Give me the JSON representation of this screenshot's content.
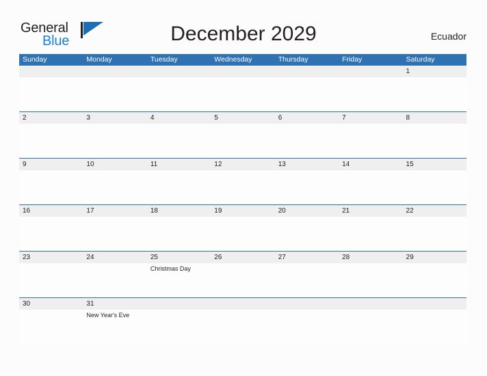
{
  "brand": {
    "name_part1": "General",
    "name_part2": "Blue",
    "flag_color": "#1f6eb4",
    "text_color": "#231f20",
    "blue_text_color": "#1b7fd4"
  },
  "header": {
    "title": "December 2029",
    "country": "Ecuador"
  },
  "theme": {
    "header_blue": "#2e72b4",
    "date_band_gray": "#efefef",
    "body_white": "#fdfdfd",
    "text_dark": "#231f20"
  },
  "calendar": {
    "weekdays": [
      "Sunday",
      "Monday",
      "Tuesday",
      "Wednesday",
      "Thursday",
      "Friday",
      "Saturday"
    ],
    "weeks": [
      {
        "days": [
          {
            "num": "",
            "event": ""
          },
          {
            "num": "",
            "event": ""
          },
          {
            "num": "",
            "event": ""
          },
          {
            "num": "",
            "event": ""
          },
          {
            "num": "",
            "event": ""
          },
          {
            "num": "",
            "event": ""
          },
          {
            "num": "1",
            "event": ""
          }
        ]
      },
      {
        "days": [
          {
            "num": "2",
            "event": ""
          },
          {
            "num": "3",
            "event": ""
          },
          {
            "num": "4",
            "event": ""
          },
          {
            "num": "5",
            "event": ""
          },
          {
            "num": "6",
            "event": ""
          },
          {
            "num": "7",
            "event": ""
          },
          {
            "num": "8",
            "event": ""
          }
        ]
      },
      {
        "days": [
          {
            "num": "9",
            "event": ""
          },
          {
            "num": "10",
            "event": ""
          },
          {
            "num": "11",
            "event": ""
          },
          {
            "num": "12",
            "event": ""
          },
          {
            "num": "13",
            "event": ""
          },
          {
            "num": "14",
            "event": ""
          },
          {
            "num": "15",
            "event": ""
          }
        ]
      },
      {
        "days": [
          {
            "num": "16",
            "event": ""
          },
          {
            "num": "17",
            "event": ""
          },
          {
            "num": "18",
            "event": ""
          },
          {
            "num": "19",
            "event": ""
          },
          {
            "num": "20",
            "event": ""
          },
          {
            "num": "21",
            "event": ""
          },
          {
            "num": "22",
            "event": ""
          }
        ]
      },
      {
        "days": [
          {
            "num": "23",
            "event": ""
          },
          {
            "num": "24",
            "event": ""
          },
          {
            "num": "25",
            "event": "Christmas Day"
          },
          {
            "num": "26",
            "event": ""
          },
          {
            "num": "27",
            "event": ""
          },
          {
            "num": "28",
            "event": ""
          },
          {
            "num": "29",
            "event": ""
          }
        ]
      },
      {
        "days": [
          {
            "num": "30",
            "event": ""
          },
          {
            "num": "31",
            "event": "New Year's Eve"
          },
          {
            "num": "",
            "event": ""
          },
          {
            "num": "",
            "event": ""
          },
          {
            "num": "",
            "event": ""
          },
          {
            "num": "",
            "event": ""
          },
          {
            "num": "",
            "event": ""
          }
        ]
      }
    ]
  }
}
